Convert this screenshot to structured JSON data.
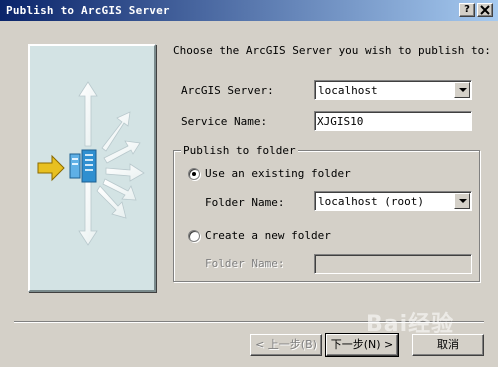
{
  "window": {
    "title": "Publish to ArcGIS Server",
    "help_label": "?",
    "close_label": "X"
  },
  "main": {
    "instruction": "Choose the ArcGIS Server you wish to publish to:",
    "server_label": "ArcGIS Server:",
    "server_value": "localhost",
    "service_name_label": "Service Name:",
    "service_name_value": "XJGIS10"
  },
  "publish_group": {
    "title": "Publish to folder",
    "use_existing_label": "Use an existing folder",
    "use_existing_checked": true,
    "existing_folder_label": "Folder Name:",
    "existing_folder_value": "localhost (root)",
    "create_new_label": "Create a new folder",
    "create_new_checked": false,
    "new_folder_label": "Folder Name:",
    "new_folder_value": ""
  },
  "buttons": {
    "back_label": "< 上一步(B)",
    "next_label": "下一步(N) >",
    "cancel_label": "取消"
  },
  "icons": {
    "illustration": "server-publish-illustration-icon",
    "arrow_color": "#e8c020",
    "server_color": "#2f8fd0"
  },
  "watermark": {
    "text": "Bai经验"
  }
}
